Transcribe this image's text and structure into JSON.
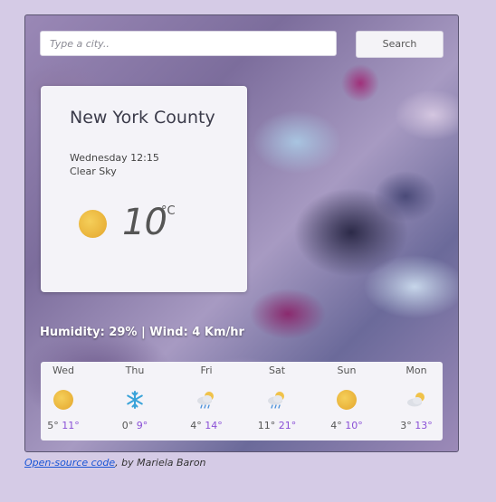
{
  "search": {
    "placeholder": "Type a city..",
    "button_label": "Search"
  },
  "current": {
    "city": "New York County",
    "datetime": "Wednesday 12:15",
    "condition": "Clear Sky",
    "icon": "sun-icon",
    "temperature": "10",
    "unit": "°C"
  },
  "details": {
    "text": "Humidity: 29% | Wind: 4 Km/hr"
  },
  "forecast": [
    {
      "day": "Wed",
      "icon": "sun-icon",
      "min": "5°",
      "max": "11°"
    },
    {
      "day": "Thu",
      "icon": "snowflake-icon",
      "min": "0°",
      "max": "9°"
    },
    {
      "day": "Fri",
      "icon": "sun-cloud-rain-icon",
      "min": "4°",
      "max": "14°"
    },
    {
      "day": "Sat",
      "icon": "sun-cloud-rain-icon",
      "min": "11°",
      "max": "21°"
    },
    {
      "day": "Sun",
      "icon": "sun-icon",
      "min": "4°",
      "max": "10°"
    },
    {
      "day": "Mon",
      "icon": "sun-cloud-icon",
      "min": "3°",
      "max": "13°"
    }
  ],
  "footer": {
    "link_text": "Open-source code",
    "byline": ", by Mariela Baron"
  },
  "colors": {
    "max_temp": "#8a4fd6",
    "sun": "#e9b23a",
    "link": "#1a55d6",
    "page_bg": "#d5cbe6"
  }
}
